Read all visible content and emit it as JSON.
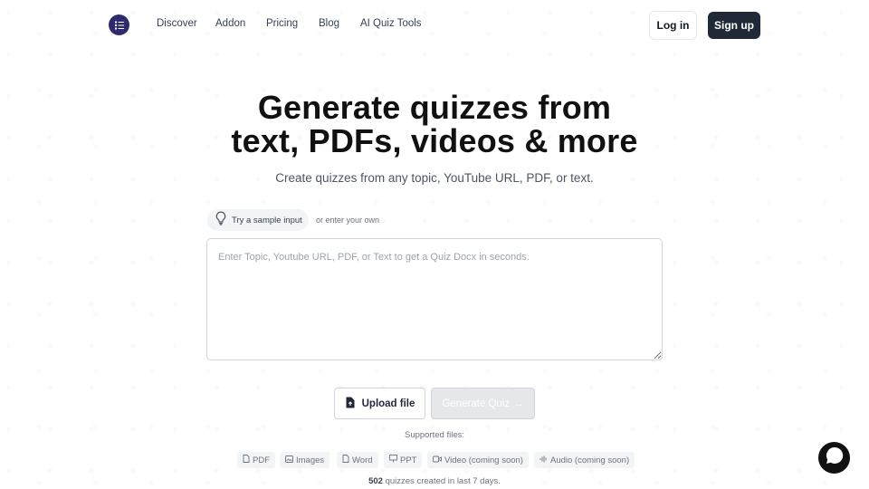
{
  "nav": {
    "logo_icon": "list-logo-icon",
    "links": [
      "Discover",
      "Addon",
      "Pricing",
      "Blog",
      "AI Quiz Tools"
    ],
    "login_label": "Log in",
    "signup_label": "Sign up"
  },
  "hero": {
    "title_line1": "Generate quizzes from",
    "title_line2": "text, PDFs, videos & more",
    "subtitle": "Create quizzes from any topic, YouTube URL, PDF, or text."
  },
  "sample": {
    "pill_label": "Try a sample input",
    "or_label": "or enter your own"
  },
  "input": {
    "placeholder": "Enter Topic, Youtube URL, PDF, or Text to get a Quiz Docx in seconds.",
    "value": ""
  },
  "actions": {
    "upload_label": "Upload file",
    "generate_label": "Generate Quiz",
    "generate_arrow": "→"
  },
  "supported": {
    "label": "Supported files:",
    "files": [
      {
        "label": "PDF",
        "icon": "file-icon"
      },
      {
        "label": "Images",
        "icon": "image-icon"
      },
      {
        "label": "Word",
        "icon": "document-icon"
      },
      {
        "label": "PPT",
        "icon": "presentation-icon"
      },
      {
        "label": "Video (coming soon)",
        "icon": "video-icon"
      },
      {
        "label": "Audio (coming soon)",
        "icon": "audio-icon"
      }
    ]
  },
  "stats": {
    "count": "502",
    "suffix": "quizzes created in last 7 days."
  },
  "colors": {
    "primary_dark": "#1f2937",
    "logo_bg": "#2e2a6e",
    "muted_text": "#6b7280"
  }
}
